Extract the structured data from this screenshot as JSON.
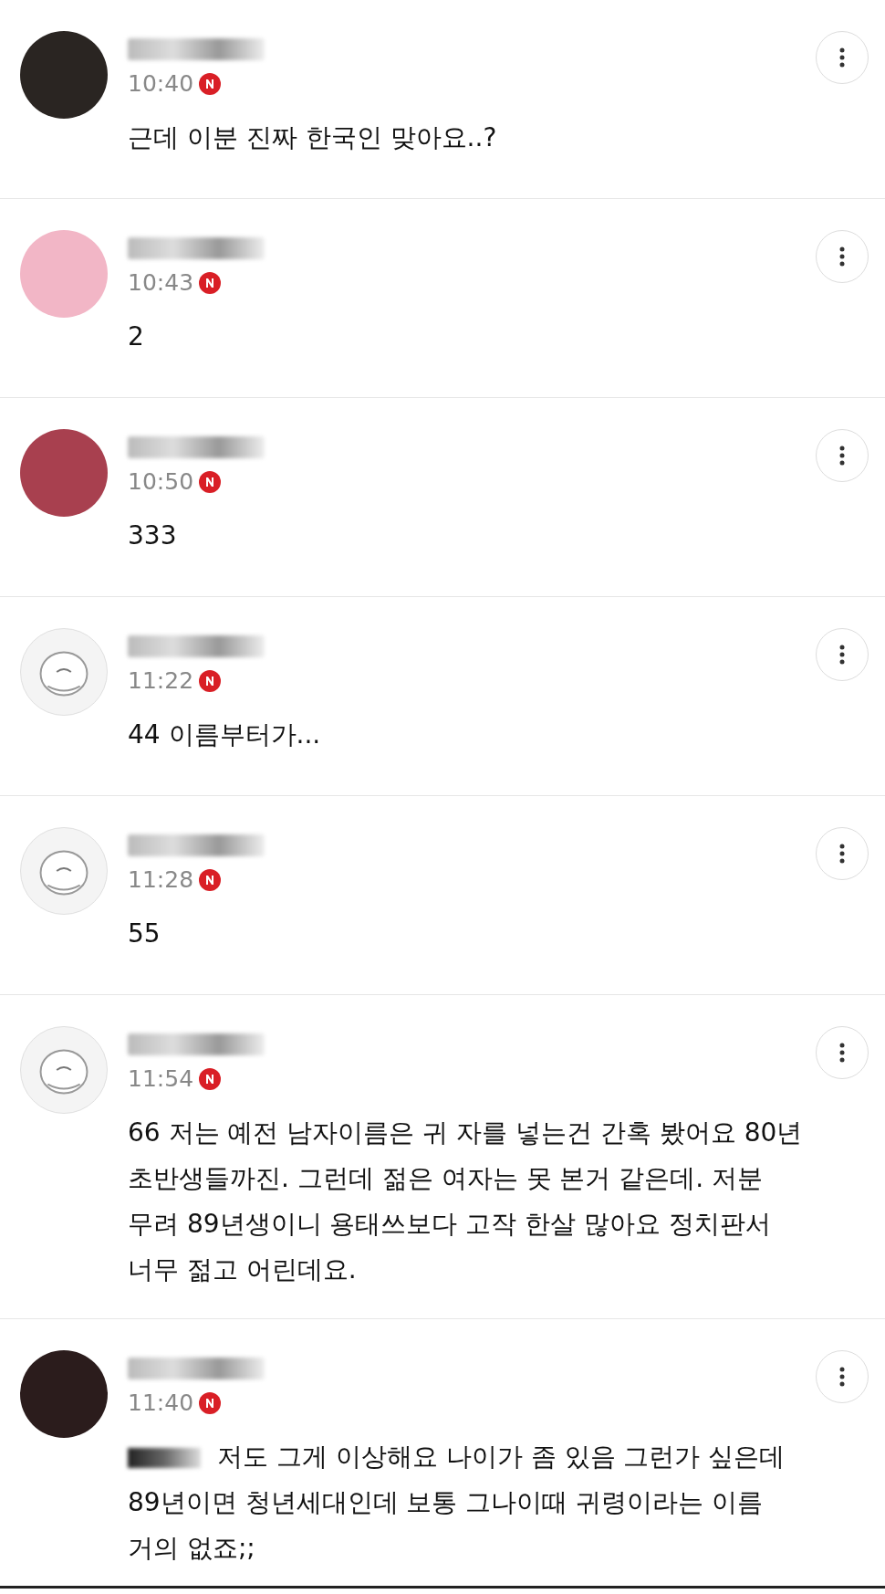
{
  "comments": [
    {
      "kind": "photo",
      "color": "#2a2522",
      "time": "10:40",
      "new": true,
      "mention_redacted": false,
      "text": "근데 이분 진짜 한국인 맞아요..?"
    },
    {
      "kind": "photo",
      "color": "#f2b6c6",
      "time": "10:43",
      "new": true,
      "mention_redacted": false,
      "text": "2"
    },
    {
      "kind": "photo",
      "color": "#a8404f",
      "time": "10:50",
      "new": true,
      "mention_redacted": false,
      "text": "333"
    },
    {
      "kind": "default",
      "time": "11:22",
      "new": true,
      "mention_redacted": false,
      "text": "44 이름부터가..."
    },
    {
      "kind": "default",
      "time": "11:28",
      "new": true,
      "mention_redacted": false,
      "text": "55"
    },
    {
      "kind": "default",
      "time": "11:54",
      "new": true,
      "mention_redacted": false,
      "text": "66 저는 예전 남자이름은 귀 자를 넣는건 간혹 봤어요 80년 초반생들까진. 그런데 젊은 여자는 못 본거 같은데. 저분 무려 89년생이니 용태쓰보다 고작 한살 많아요 정치판서 너무 젊고 어린데요."
    },
    {
      "kind": "photo",
      "color": "#2b1c1c",
      "time": "11:40",
      "new": true,
      "mention_redacted": true,
      "text": "저도 그게 이상해요 나이가 좀 있음 그런가 싶은데 89년이면 청년세대인데 보통 그나이때 귀령이라는 이름 거의 없죠;;"
    }
  ]
}
